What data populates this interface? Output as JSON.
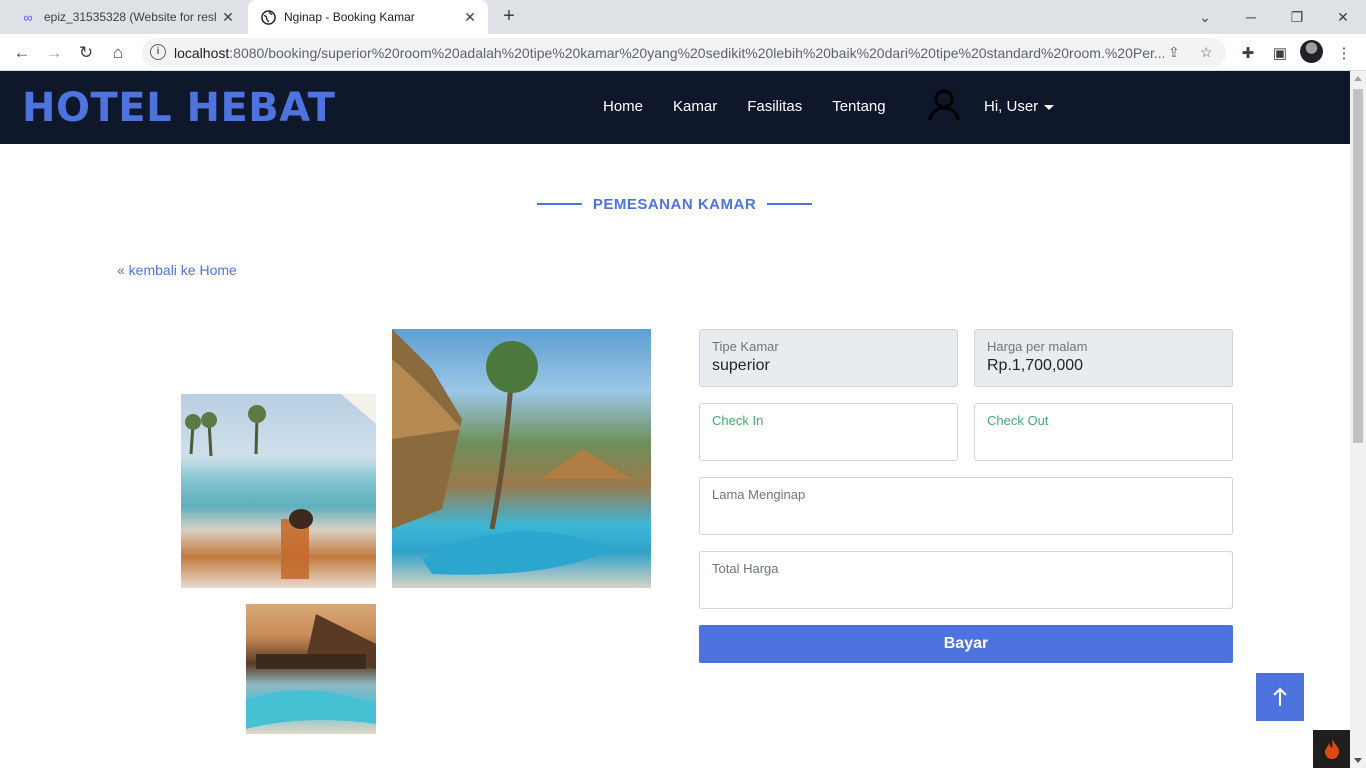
{
  "browser": {
    "tabs": [
      {
        "title": "epiz_31535328 (Website for resh",
        "active": false
      },
      {
        "title": "Nginap - Booking Kamar",
        "active": true
      }
    ],
    "url_host": "localhost",
    "url_rest": ":8080/booking/superior%20room%20adalah%20tipe%20kamar%20yang%20sedikit%20lebih%20baik%20dari%20tipe%20standard%20room.%20Per..."
  },
  "navbar": {
    "brand": "HOTEL HEBAT",
    "links": [
      "Home",
      "Kamar",
      "Fasilitas",
      "Tentang"
    ],
    "user_label": "Hi, User"
  },
  "section": {
    "title": "PEMESANAN KAMAR",
    "back_link": "« kembali ke Home"
  },
  "form": {
    "tipe_kamar": {
      "label": "Tipe Kamar",
      "value": "superior"
    },
    "harga": {
      "label": "Harga per malam",
      "value": "Rp.1,700,000"
    },
    "check_in": {
      "label": "Check In",
      "value": ""
    },
    "check_out": {
      "label": "Check Out",
      "value": ""
    },
    "lama": {
      "label": "Lama Menginap",
      "value": ""
    },
    "total": {
      "label": "Total Harga",
      "value": ""
    },
    "submit_label": "Bayar"
  },
  "colors": {
    "accent": "#4e73df",
    "navbar_bg": "#0f172a",
    "label_green": "#3fae6f"
  }
}
